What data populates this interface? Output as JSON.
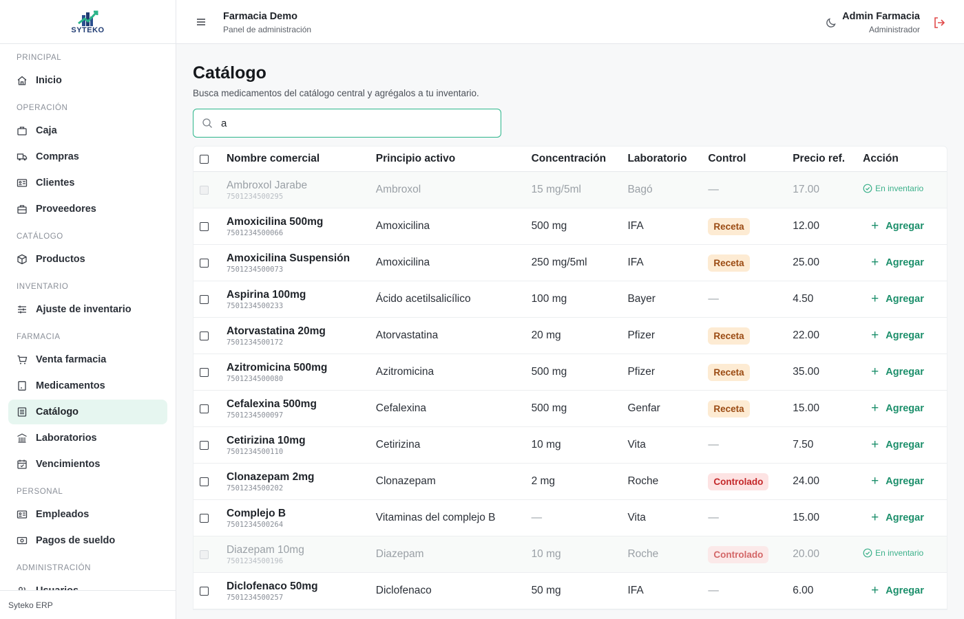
{
  "brand": {
    "logo_text": "SYTEKO",
    "footer": "Syteko ERP"
  },
  "header": {
    "title": "Farmacia Demo",
    "subtitle": "Panel de administración",
    "user_name": "Admin Farmacia",
    "user_role": "Administrador"
  },
  "sidebar": {
    "sections": [
      {
        "label": "PRINCIPAL",
        "items": [
          {
            "label": "Inicio",
            "icon": "home-icon"
          }
        ]
      },
      {
        "label": "OPERACIÓN",
        "items": [
          {
            "label": "Caja",
            "icon": "briefcase-icon"
          },
          {
            "label": "Compras",
            "icon": "truck-icon"
          },
          {
            "label": "Clientes",
            "icon": "id-card-icon"
          },
          {
            "label": "Proveedores",
            "icon": "toolbox-icon"
          }
        ]
      },
      {
        "label": "CATÁLOGO",
        "items": [
          {
            "label": "Productos",
            "icon": "box-icon"
          }
        ]
      },
      {
        "label": "INVENTARIO",
        "items": [
          {
            "label": "Ajuste de inventario",
            "icon": "sliders-icon"
          }
        ]
      },
      {
        "label": "FARMACIA",
        "items": [
          {
            "label": "Venta farmacia",
            "icon": "cart-icon"
          },
          {
            "label": "Medicamentos",
            "icon": "document-icon"
          },
          {
            "label": "Catálogo",
            "icon": "list-icon",
            "active": true
          },
          {
            "label": "Laboratorios",
            "icon": "building-icon"
          },
          {
            "label": "Vencimientos",
            "icon": "calendar-icon"
          }
        ]
      },
      {
        "label": "PERSONAL",
        "items": [
          {
            "label": "Empleados",
            "icon": "id-card-icon"
          },
          {
            "label": "Pagos de sueldo",
            "icon": "money-icon"
          }
        ]
      },
      {
        "label": "ADMINISTRACIÓN",
        "items": [
          {
            "label": "Usuarios",
            "icon": "users-icon"
          }
        ]
      }
    ]
  },
  "page": {
    "title": "Catálogo",
    "subtitle": "Busca medicamentos del catálogo central y agrégalos a tu inventario.",
    "search_value": "a"
  },
  "table": {
    "headers": [
      "Nombre comercial",
      "Principio activo",
      "Concentración",
      "Laboratorio",
      "Control",
      "Precio ref.",
      "Acción"
    ],
    "add_label": "Agregar",
    "owned_label": "En inventario",
    "rows": [
      {
        "name": "Ambroxol Jarabe",
        "code": "7501234500295",
        "active": "Ambroxol",
        "conc": "15 mg/5ml",
        "lab": "Bagó",
        "control": "—",
        "control_type": "none",
        "price": "17.00",
        "owned": true
      },
      {
        "name": "Amoxicilina 500mg",
        "code": "7501234500066",
        "active": "Amoxicilina",
        "conc": "500 mg",
        "lab": "IFA",
        "control": "Receta",
        "control_type": "rx",
        "price": "12.00",
        "owned": false
      },
      {
        "name": "Amoxicilina Suspensión",
        "code": "7501234500073",
        "active": "Amoxicilina",
        "conc": "250 mg/5ml",
        "lab": "IFA",
        "control": "Receta",
        "control_type": "rx",
        "price": "25.00",
        "owned": false
      },
      {
        "name": "Aspirina 100mg",
        "code": "7501234500233",
        "active": "Ácido acetilsalicílico",
        "conc": "100 mg",
        "lab": "Bayer",
        "control": "—",
        "control_type": "none",
        "price": "4.50",
        "owned": false
      },
      {
        "name": "Atorvastatina 20mg",
        "code": "7501234500172",
        "active": "Atorvastatina",
        "conc": "20 mg",
        "lab": "Pfizer",
        "control": "Receta",
        "control_type": "rx",
        "price": "22.00",
        "owned": false
      },
      {
        "name": "Azitromicina 500mg",
        "code": "7501234500080",
        "active": "Azitromicina",
        "conc": "500 mg",
        "lab": "Pfizer",
        "control": "Receta",
        "control_type": "rx",
        "price": "35.00",
        "owned": false
      },
      {
        "name": "Cefalexina 500mg",
        "code": "7501234500097",
        "active": "Cefalexina",
        "conc": "500 mg",
        "lab": "Genfar",
        "control": "Receta",
        "control_type": "rx",
        "price": "15.00",
        "owned": false
      },
      {
        "name": "Cetirizina 10mg",
        "code": "7501234500110",
        "active": "Cetirizina",
        "conc": "10 mg",
        "lab": "Vita",
        "control": "—",
        "control_type": "none",
        "price": "7.50",
        "owned": false
      },
      {
        "name": "Clonazepam 2mg",
        "code": "7501234500202",
        "active": "Clonazepam",
        "conc": "2 mg",
        "lab": "Roche",
        "control": "Controlado",
        "control_type": "ctl",
        "price": "24.00",
        "owned": false
      },
      {
        "name": "Complejo B",
        "code": "7501234500264",
        "active": "Vitaminas del complejo B",
        "conc": "—",
        "lab": "Vita",
        "control": "—",
        "control_type": "none",
        "price": "15.00",
        "owned": false
      },
      {
        "name": "Diazepam 10mg",
        "code": "7501234500196",
        "active": "Diazepam",
        "conc": "10 mg",
        "lab": "Roche",
        "control": "Controlado",
        "control_type": "ctl",
        "price": "20.00",
        "owned": true
      },
      {
        "name": "Diclofenaco 50mg",
        "code": "7501234500257",
        "active": "Diclofenaco",
        "conc": "50 mg",
        "lab": "IFA",
        "control": "—",
        "control_type": "none",
        "price": "6.00",
        "owned": false
      }
    ]
  },
  "colors": {
    "accent": "#1c8f6b",
    "active_bg": "#e6f6f0",
    "rx_bg": "#fdebd3",
    "ctl_bg": "#fde3e3"
  }
}
